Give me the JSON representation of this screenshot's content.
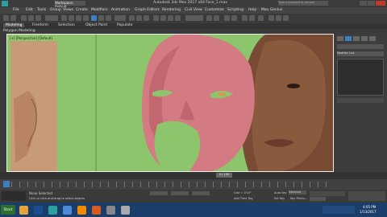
{
  "app": {
    "title": "Autodesk 3ds Max 2017  x64    Face_1.max",
    "workspace": "Workspace: Default"
  },
  "menu": [
    "File",
    "Edit",
    "Tools",
    "Group",
    "Views",
    "Create",
    "Modifiers",
    "Animation",
    "Graph Editors",
    "Rendering",
    "Civil View",
    "Customize",
    "Scripting",
    "Help",
    "Max Genius"
  ],
  "search_placeholder": "Type a keyword or phrase",
  "ribbon_tabs": [
    "Modeling",
    "Freeform",
    "Selection",
    "Object Paint",
    "Populate"
  ],
  "ribbon_sub": "Polygon Modeling",
  "viewport_label": "[+] [Perspective] [Default]",
  "modifier_list": "Modifier List",
  "timeline_label": "0 / 100",
  "status": {
    "selected": "None Selected",
    "hint": "Click or click-and-drag to select objects",
    "grid": "Grid = 0'10\"",
    "add_time_tag": "Add Time Tag",
    "autokey": "Auto Key",
    "set_key": "Set Key",
    "selected_mode": "Selected",
    "key_filters": "Key Filters..."
  },
  "taskbar": {
    "start": "Start",
    "time": "4:05 PM",
    "date": "1/13/2017"
  }
}
